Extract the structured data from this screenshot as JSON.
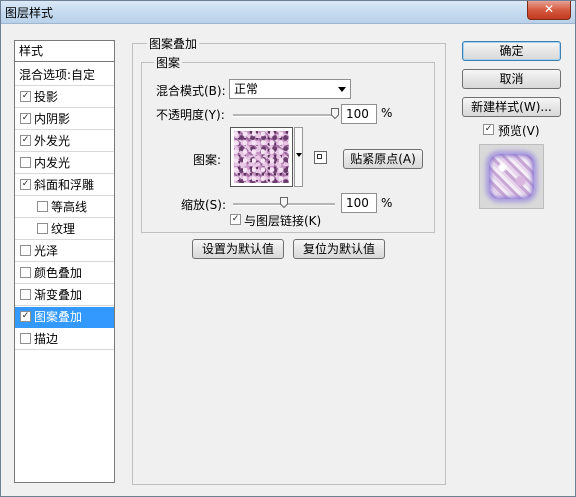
{
  "window": {
    "title": "图层样式",
    "close": "✕"
  },
  "sidebar": {
    "header": "样式",
    "items": [
      {
        "label": "混合选项:自定",
        "checkbox": false,
        "checked": false,
        "indent": 0,
        "selected": false
      },
      {
        "label": "投影",
        "checkbox": true,
        "checked": true,
        "indent": 0,
        "selected": false
      },
      {
        "label": "内阴影",
        "checkbox": true,
        "checked": true,
        "indent": 0,
        "selected": false
      },
      {
        "label": "外发光",
        "checkbox": true,
        "checked": true,
        "indent": 0,
        "selected": false
      },
      {
        "label": "内发光",
        "checkbox": true,
        "checked": false,
        "indent": 0,
        "selected": false
      },
      {
        "label": "斜面和浮雕",
        "checkbox": true,
        "checked": true,
        "indent": 0,
        "selected": false
      },
      {
        "label": "等高线",
        "checkbox": true,
        "checked": false,
        "indent": 1,
        "selected": false
      },
      {
        "label": "纹理",
        "checkbox": true,
        "checked": false,
        "indent": 1,
        "selected": false
      },
      {
        "label": "光泽",
        "checkbox": true,
        "checked": false,
        "indent": 0,
        "selected": false
      },
      {
        "label": "颜色叠加",
        "checkbox": true,
        "checked": false,
        "indent": 0,
        "selected": false
      },
      {
        "label": "渐变叠加",
        "checkbox": true,
        "checked": false,
        "indent": 0,
        "selected": false
      },
      {
        "label": "图案叠加",
        "checkbox": true,
        "checked": true,
        "indent": 0,
        "selected": true
      },
      {
        "label": "描边",
        "checkbox": true,
        "checked": false,
        "indent": 0,
        "selected": false
      }
    ]
  },
  "panel": {
    "group_title": "图案叠加",
    "subgroup_title": "图案",
    "blend_mode_label": "混合模式(B):",
    "blend_mode_value": "正常",
    "opacity_label": "不透明度(Y):",
    "opacity_value": "100",
    "opacity_unit": "%",
    "opacity_level": 1.0,
    "pattern_label": "图案:",
    "snap_origin_button": "贴紧原点(A)",
    "scale_label": "缩放(S):",
    "scale_value": "100",
    "scale_unit": "%",
    "scale_level": 0.5,
    "link_layer_label": "与图层链接(K)",
    "link_layer_checked": true,
    "set_default_button": "设置为默认值",
    "reset_default_button": "复位为默认值"
  },
  "right": {
    "ok_button": "确定",
    "cancel_button": "取消",
    "new_style_button": "新建样式(W)...",
    "preview_label": "预览(V)",
    "preview_checked": true
  },
  "colors": {
    "selection": "#3399ff",
    "pattern_tint": "#c995c5",
    "glow": "#a79ae0"
  }
}
